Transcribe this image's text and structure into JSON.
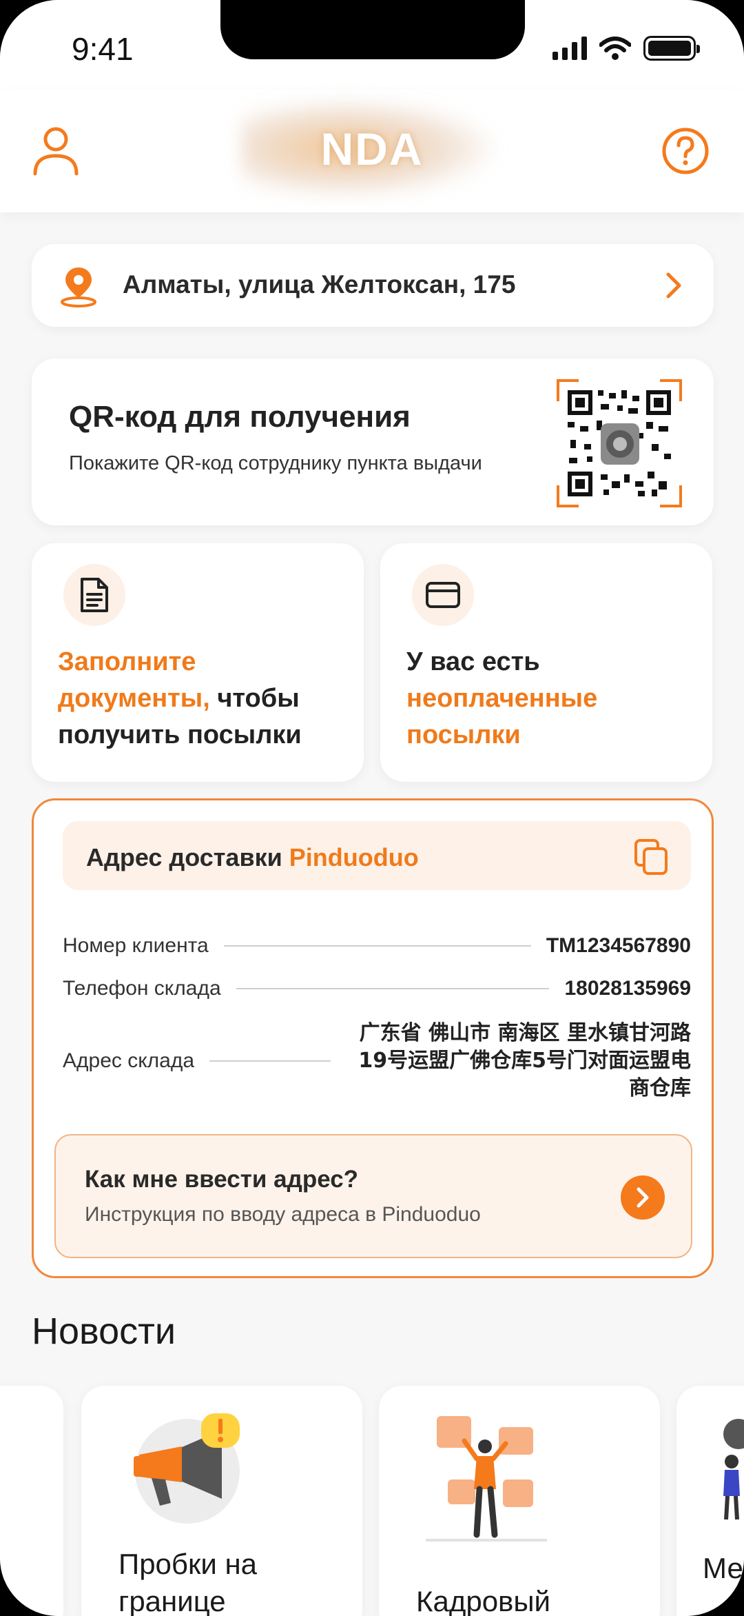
{
  "status_bar": {
    "time": "9:41"
  },
  "header": {
    "logo_text": "NDA"
  },
  "address": {
    "text": "Алматы, улица Желтоксан, 175"
  },
  "qr": {
    "title": "QR-код для получения",
    "subtitle": "Покажите QR-код сотруднику пункта выдачи"
  },
  "tiles": {
    "documents": {
      "part1": "Заполните документы,",
      "part2": " чтобы получить посылки"
    },
    "unpaid": {
      "part1": "У вас есть ",
      "part2": "неоплаченные посылки"
    }
  },
  "delivery": {
    "header_prefix": "Адрес доставки ",
    "header_brand": "Pinduoduo",
    "rows": [
      {
        "label": "Номер клиента",
        "value": "TM1234567890"
      },
      {
        "label": "Телефон склада",
        "value": "18028135969"
      },
      {
        "label": "Адрес склада",
        "value": "广东省 佛山市 南海区 里水镇甘河路19号运盟广佛仓库5号门对面运盟电商仓库"
      }
    ],
    "howto": {
      "title": "Как мне ввести адрес?",
      "subtitle": "Инструкция по вводу адреса в Pinduoduo"
    }
  },
  "news": {
    "title": "Новости",
    "items": [
      {
        "title": ""
      },
      {
        "title": "Пробки на границе"
      },
      {
        "title": "Кадровый"
      },
      {
        "title": "Ме..."
      }
    ]
  },
  "colors": {
    "accent": "#f47a1c",
    "background": "#f7f7f7",
    "card": "#ffffff"
  }
}
